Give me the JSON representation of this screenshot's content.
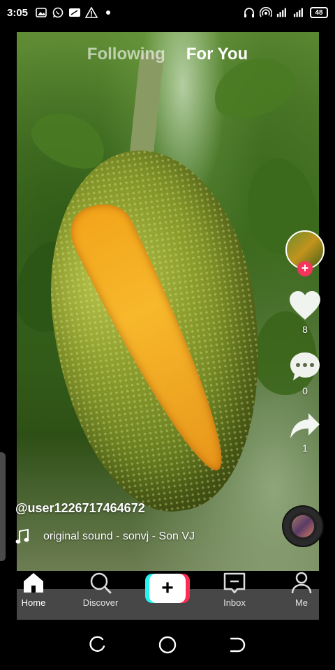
{
  "status_bar": {
    "time": "3:05",
    "left_icons": [
      "gallery-icon",
      "whatsapp-icon",
      "message-icon",
      "warning-icon",
      "dot-icon"
    ],
    "right_icons": [
      "headphones-icon",
      "hotspot-icon",
      "signal-4g-icon",
      "signal-icon"
    ],
    "battery": "48"
  },
  "top_tabs": {
    "following": "Following",
    "for_you": "For You",
    "active": "For You"
  },
  "rail": {
    "likes": "8",
    "comments": "0",
    "shares": "1"
  },
  "video": {
    "username": "@user1226717464672",
    "sound": "original sound - sonvj - Son VJ"
  },
  "bottom_nav": {
    "items": [
      {
        "label": "Home",
        "icon": "home-icon",
        "active": true
      },
      {
        "label": "Discover",
        "icon": "search-icon",
        "active": false
      },
      {
        "label": "",
        "icon": "plus-icon",
        "active": false
      },
      {
        "label": "Inbox",
        "icon": "inbox-icon",
        "active": false
      },
      {
        "label": "Me",
        "icon": "person-icon",
        "active": false
      }
    ]
  },
  "colors": {
    "accent_red": "#fe2c55",
    "accent_cyan": "#25f4ee",
    "follow_badge": "#f4345c"
  }
}
